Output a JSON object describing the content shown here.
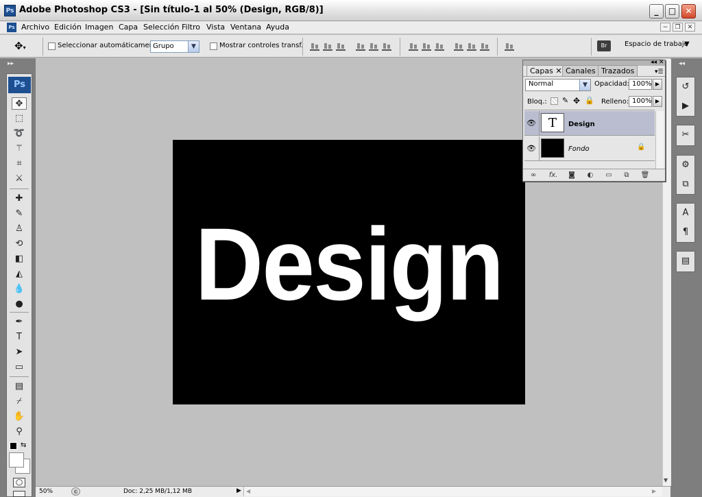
{
  "window": {
    "app_icon": "Ps",
    "title": "Adobe Photoshop CS3 - [Sin título-1 al 50% (Design, RGB/8)]",
    "buttons": {
      "minimize": "_",
      "maximize": "□",
      "close": "✕"
    }
  },
  "menubar": {
    "doc_icon": "Ps",
    "items": [
      "Archivo",
      "Edición",
      "Imagen",
      "Capa",
      "Selección",
      "Filtro",
      "Vista",
      "Ventana",
      "Ayuda"
    ],
    "mdi": [
      "−",
      "❐",
      "✕"
    ]
  },
  "options_bar": {
    "tool_icon": "move-tool-icon",
    "auto_select_label": "Seleccionar automáticamente:",
    "auto_select_value": "Grupo",
    "transform_controls_label": "Mostrar controles transf.",
    "workspace_label": "Espacio de trabajo",
    "workspace_arrow": "▼"
  },
  "toolbox": {
    "logo": "Ps",
    "tools": [
      {
        "name": "move-tool-icon",
        "glyph": "✥"
      },
      {
        "name": "marquee-tool-icon",
        "glyph": "⬚"
      },
      {
        "name": "lasso-tool-icon",
        "glyph": "➰"
      },
      {
        "name": "magic-wand-tool-icon",
        "glyph": "⚚"
      },
      {
        "name": "crop-tool-icon",
        "glyph": "⌗"
      },
      {
        "name": "slice-tool-icon",
        "glyph": "⚔"
      },
      {
        "name": "healing-brush-tool-icon",
        "glyph": "✚"
      },
      {
        "name": "brush-tool-icon",
        "glyph": "✎"
      },
      {
        "name": "clone-stamp-tool-icon",
        "glyph": "♙"
      },
      {
        "name": "history-brush-tool-icon",
        "glyph": "⟲"
      },
      {
        "name": "eraser-tool-icon",
        "glyph": "◧"
      },
      {
        "name": "paint-bucket-tool-icon",
        "glyph": "◭"
      },
      {
        "name": "blur-tool-icon",
        "glyph": "💧"
      },
      {
        "name": "dodge-tool-icon",
        "glyph": "●"
      },
      {
        "name": "pen-tool-icon",
        "glyph": "✒"
      },
      {
        "name": "type-tool-icon",
        "glyph": "T"
      },
      {
        "name": "path-selection-tool-icon",
        "glyph": "➤"
      },
      {
        "name": "shape-tool-icon",
        "glyph": "▭"
      },
      {
        "name": "notes-tool-icon",
        "glyph": "▤"
      },
      {
        "name": "eyedropper-tool-icon",
        "glyph": "⌿"
      },
      {
        "name": "hand-tool-icon",
        "glyph": "✋"
      },
      {
        "name": "zoom-tool-icon",
        "glyph": "⚲"
      }
    ]
  },
  "right_dock": {
    "icons": [
      {
        "name": "history-panel-icon",
        "glyph": "↺"
      },
      {
        "name": "actions-panel-icon",
        "glyph": "▶"
      },
      {
        "name": "tool-presets-panel-icon",
        "glyph": "✂"
      },
      {
        "name": "brushes-panel-icon",
        "glyph": "⚙"
      },
      {
        "name": "clone-source-panel-icon",
        "glyph": "⧉"
      },
      {
        "name": "character-panel-icon",
        "glyph": "A"
      },
      {
        "name": "paragraph-panel-icon",
        "glyph": "¶"
      },
      {
        "name": "layer-comps-panel-icon",
        "glyph": "▤"
      }
    ]
  },
  "canvas": {
    "background_color": "#000000",
    "text": "Design",
    "text_color": "#ffffff"
  },
  "status_bar": {
    "zoom": "50%",
    "doc_info": "Doc: 2,25 MB/1,12 MB"
  },
  "layers_panel": {
    "tabs": [
      "Capas",
      "Canales",
      "Trazados"
    ],
    "active_tab": "Capas",
    "blend_mode": "Normal",
    "opacity_label": "Opacidad:",
    "opacity_value": "100%",
    "lock_label": "Bloq.:",
    "fill_label": "Relleno:",
    "fill_value": "100%",
    "layers": [
      {
        "name": "Design",
        "type": "text",
        "thumb": "T",
        "selected": true
      },
      {
        "name": "Fondo",
        "type": "background",
        "locked": true,
        "selected": false
      }
    ]
  },
  "colors": {
    "accent": "#1d4f91",
    "canvas_bg": "#c0c0c0",
    "selected_layer": "#b9bdcf"
  }
}
